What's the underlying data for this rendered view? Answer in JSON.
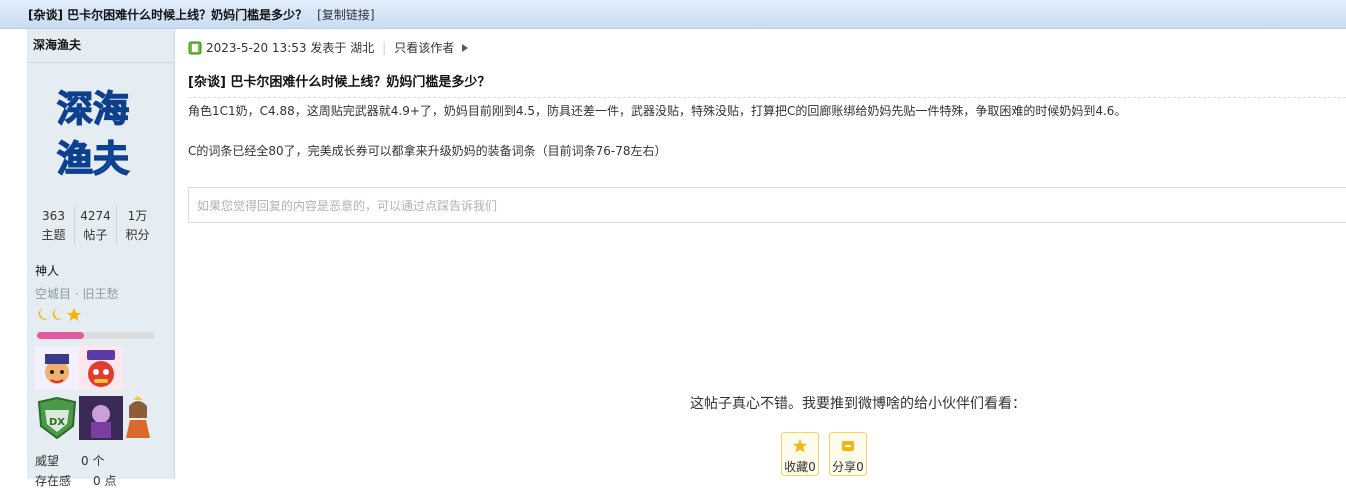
{
  "thread": {
    "title": "[杂谈] 巴卡尔困难什么时候上线？奶妈门槛是多少？",
    "copy_link": "[复制链接]"
  },
  "author": {
    "name": "深海渔夫",
    "avatar_text_line1": "深海",
    "avatar_text_line2": "渔夫",
    "stats": [
      {
        "value": "363",
        "label": "主题"
      },
      {
        "value": "4274",
        "label": "帖子"
      },
      {
        "value": "1万",
        "label": "积分"
      }
    ],
    "group": "神人",
    "subtitle": "空城目 · 旧王愁",
    "level_progress": 0.4,
    "reputation": [
      {
        "label": "威望",
        "value": "0 个"
      },
      {
        "label": "存在感",
        "value": "0 点"
      }
    ],
    "medals": [
      "medal-chibi-love",
      "medal-love-bird",
      "medal-dx-shield",
      "medal-dark-character",
      "medal-princess"
    ]
  },
  "post": {
    "meta_date": "2023-5-20 13:53 发表于 湖北",
    "only_author": "只看该作者",
    "title": "[杂谈] 巴卡尔困难什么时候上线？奶妈门槛是多少？",
    "paragraph1": "角色1C1奶，C4.88，这周贴完武器就4.9+了，奶妈目前刚到4.5，防具还差一件，武器没贴，特殊没贴，打算把C的回廊账绑给奶妈先贴一件特殊，争取困难的时候奶妈到4.6。",
    "paragraph2": "C的词条已经全80了，完美成长券可以都拿来升级奶妈的装备词条（目前词条76-78左右）",
    "report_hint": "如果您觉得回复的内容是恶意的，可以通过点踩告诉我们",
    "share_text": "这帖子真心不错。我要推到微博啥的给小伙伴们看看：",
    "favorite_label": "收藏0",
    "share_label": "分享0"
  }
}
